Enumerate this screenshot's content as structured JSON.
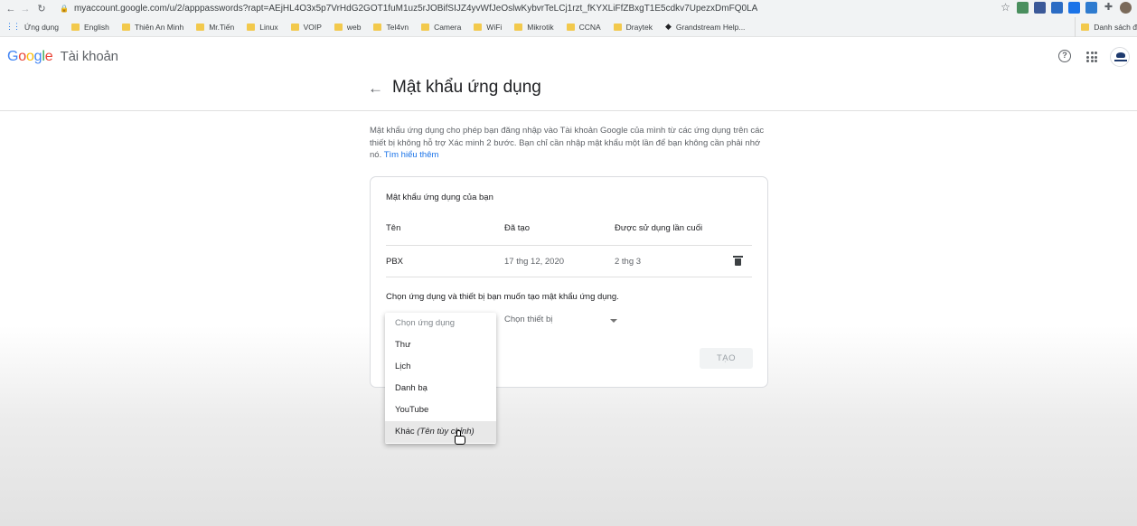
{
  "browser": {
    "url": "myaccount.google.com/u/2/apppasswords?rapt=AEjHL4O3x5p7VrHdG2GOT1fuM1uz5rJOBifSIJZ4yvWfJeOslwKybvrTeLCj1rzt_fKYXLiFfZBxgT1E5cdkv7UpezxDmFQ0LA",
    "bookmarks": [
      "Ứng dụng",
      "English",
      "Thiên An Minh",
      "Mr.Tiến",
      "Linux",
      "VOIP",
      "web",
      "Tel4vn",
      "Camera",
      "WiFi",
      "Mikrotik",
      "CCNA",
      "Draytek",
      "Grandstream Help..."
    ],
    "bookmarks_right": "Danh sách đ"
  },
  "header": {
    "logo_letters": [
      "G",
      "o",
      "o",
      "g",
      "l",
      "e"
    ],
    "product": "Tài khoản"
  },
  "page": {
    "title": "Mật khẩu ứng dụng",
    "description": "Mật khẩu ứng dụng cho phép bạn đăng nhập vào Tài khoản Google của mình từ các ứng dụng trên các thiết bị không hỗ trợ Xác minh 2 bước. Bạn chỉ cần nhập mật khẩu một lần để bạn không cần phải nhớ nó.",
    "learn_more": "Tìm hiểu thêm"
  },
  "card": {
    "title": "Mật khẩu ứng dụng của bạn",
    "columns": [
      "Tên",
      "Đã tạo",
      "Được sử dụng lần cuối"
    ],
    "rows": [
      {
        "name": "PBX",
        "created": "17 thg 12, 2020",
        "last_used": "2 thg 3"
      }
    ],
    "choose_prompt": "Chọn ứng dụng và thiết bị bạn muốn tạo mật khẩu ứng dụng.",
    "device_placeholder": "Chọn thiết bị",
    "create_button": "TẠO"
  },
  "menu": {
    "placeholder": "Chọn ứng dụng",
    "items": [
      "Thư",
      "Lịch",
      "Danh bạ",
      "YouTube"
    ],
    "custom_item": "Khác",
    "custom_item_hint": "(Tên tùy chỉnh)"
  }
}
